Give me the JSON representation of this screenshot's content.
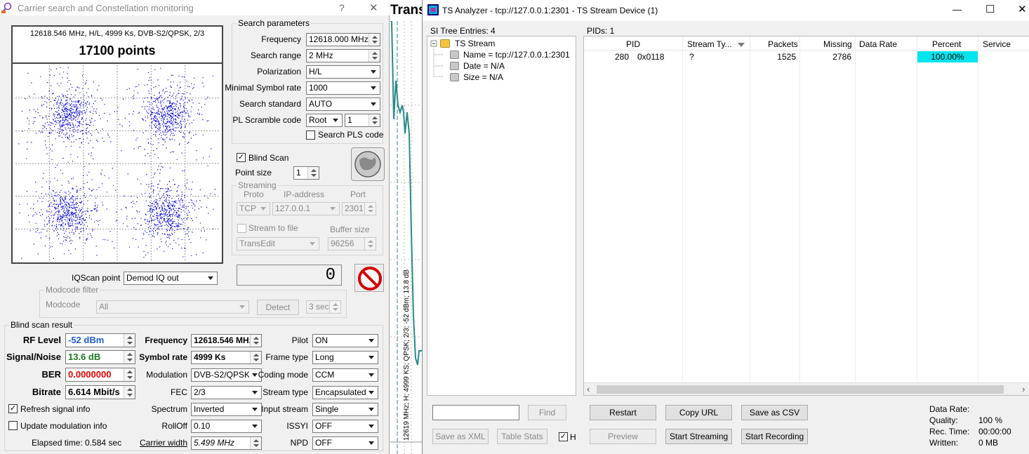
{
  "left_window": {
    "title": "Carrier search and Constellation monitoring",
    "help_label": "?",
    "close_label": "✕",
    "constellation": {
      "info": "12618.546 MHz, H/L, 4999 Ks, DVB-S2/QPSK, 2/3",
      "points_label": "17100 points"
    },
    "search_parameters": {
      "title": "Search parameters",
      "frequency_label": "Frequency",
      "frequency_value": "12618.000 MHz",
      "search_range_label": "Search range",
      "search_range_value": "2 MHz",
      "polarization_label": "Polarization",
      "polarization_value": "H/L",
      "min_symbol_rate_label": "Minimal Symbol rate",
      "min_symbol_rate_value": "1000",
      "search_standard_label": "Search standard",
      "search_standard_value": "AUTO",
      "pl_scramble_label": "PL Scramble code",
      "pl_scramble_value": "Root",
      "pl_scramble_num": "1",
      "search_pls_label": "Search PLS code"
    },
    "blind_scan_label": "Blind Scan",
    "point_size_label": "Point size",
    "point_size_value": "1",
    "streaming": {
      "title": "Streaming",
      "proto_label": "Proto",
      "ip_label": "IP-address",
      "port_label": "Port",
      "proto_value": "TCP",
      "ip_value": "127.0.0.1",
      "port_value": "2301",
      "stream_to_file_label": "Stream to file",
      "buffer_size_label": "Buffer size",
      "file_value": "TransEdit",
      "buffer_value": "96256"
    },
    "counter_value": "0",
    "iqscan_label": "IQScan point",
    "iqscan_value": "Demod IQ out",
    "modcode_filter": {
      "title": "Modcode filter",
      "modcode_label": "Modcode",
      "modcode_value": "All",
      "detect_label": "Detect",
      "time_value": "3 sec"
    },
    "blind_result": {
      "title": "Blind scan result",
      "rf_level_label": "RF Level",
      "rf_level_value": "-52 dBm",
      "snr_label": "Signal/Noise",
      "snr_value": "13.6 dB",
      "ber_label": "BER",
      "ber_value": "0.0000000",
      "bitrate_label": "Bitrate",
      "bitrate_value": "6.614 Mbit/s",
      "frequency_label": "Frequency",
      "frequency_value": "12618.546 MHz",
      "symbol_rate_label": "Symbol rate",
      "symbol_rate_value": "4999 Ks",
      "modulation_label": "Modulation",
      "modulation_value": "DVB-S2/QPSK",
      "fec_label": "FEC",
      "fec_value": "2/3",
      "spectrum_label": "Spectrum",
      "spectrum_value": "Inverted",
      "rolloff_label": "RollOff",
      "rolloff_value": "0.10",
      "carrier_width_label": "Carrier width",
      "carrier_width_value": "5.499 MHz",
      "pilot_label": "Pilot",
      "pilot_value": "ON",
      "frame_type_label": "Frame type",
      "frame_type_value": "Long",
      "coding_mode_label": "Coding mode",
      "coding_mode_value": "CCM",
      "stream_type_label": "Stream type",
      "stream_type_value": "Encapsulated",
      "input_stream_label": "Input stream",
      "input_stream_value": "Single",
      "issyi_label": "ISSYI",
      "issyi_value": "OFF",
      "npd_label": "NPD",
      "npd_value": "OFF"
    },
    "refresh_label": "Refresh signal info",
    "update_mod_label": "Update modulation info",
    "elapsed_label": "Elapsed time: 0.584 sec"
  },
  "background_window": {
    "title_fragment": "Trans",
    "vertical_text": "12619 MHz; H; 4999 KS; QPSK; 2/3; -52 dBm; 13.8 dB"
  },
  "ts_window": {
    "title": "TS Analyzer - tcp://127.0.0.1:2301 - TS Stream Device (1)",
    "minimize_label": "—",
    "maximize_label": "☐",
    "close_label": "✕",
    "si_tree_label": "SI Tree Entries: 4",
    "tree": {
      "root": "TS Stream",
      "children": [
        "Name = tcp://127.0.0.1:2301",
        "Date = N/A",
        "Size = N/A"
      ]
    },
    "pids_label": "PIDs: 1",
    "columns": [
      "PID",
      "Stream Ty...",
      "Packets",
      "Missing",
      "Data Rate",
      "Percent",
      "Service"
    ],
    "rows": [
      {
        "pid": "280",
        "pid_hex": "0x0118",
        "stream_type": "?",
        "packets": "1525",
        "missing": "2786",
        "data_rate": "",
        "percent": "100.00%",
        "service": ""
      }
    ],
    "find_label": "Find",
    "save_xml_label": "Save as XML",
    "table_stats_label": "Table Stats",
    "h_checkbox_label": "H",
    "restart_label": "Restart",
    "copy_url_label": "Copy URL",
    "save_csv_label": "Save as CSV",
    "preview_label": "Preview",
    "start_streaming_label": "Start Streaming",
    "start_recording_label": "Start Recording",
    "stats": {
      "data_rate_label": "Data Rate:",
      "data_rate_value": "",
      "quality_label": "Quality:",
      "quality_value": "100 %",
      "rec_time_label": "Rec. Time:",
      "rec_time_value": "00:00:00",
      "written_label": "Written:",
      "written_value": "0 MB"
    }
  },
  "colors": {
    "constellation_points": "#0000dd",
    "percent_bar": "#00e5ee",
    "rf_level_text": "#1f5fd0",
    "snr_text": "#1a7a1a",
    "ber_text": "#e00000",
    "spectrum_trace": "#2a8a8a"
  },
  "constellation_data": {
    "type": "scatter",
    "modulation": "QPSK",
    "clusters": [
      [
        -1,
        1
      ],
      [
        1,
        1
      ],
      [
        -1,
        -1
      ],
      [
        1,
        -1
      ]
    ],
    "total_points": 17100
  }
}
